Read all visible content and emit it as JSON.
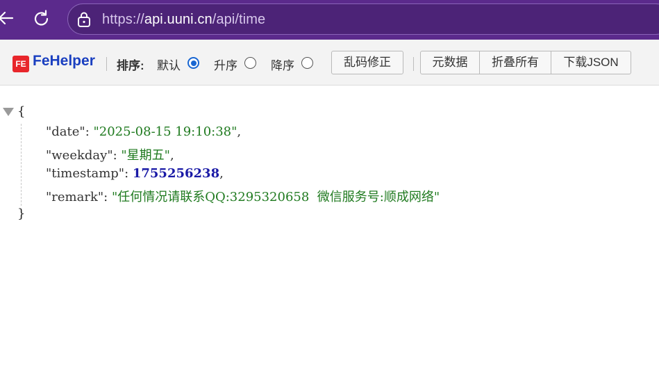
{
  "browser": {
    "url_base": "https://",
    "url_host": "api.uuni.cn",
    "url_path": "/api/time"
  },
  "toolbar": {
    "logo_badge": "FE",
    "logo_text": "FeHelper",
    "sort_label": "排序:",
    "sort_options": [
      {
        "label": "默认",
        "selected": true
      },
      {
        "label": "升序",
        "selected": false
      },
      {
        "label": "降序",
        "selected": false
      }
    ],
    "fix_encoding_label": "乱码修正",
    "metadata_label": "元数据",
    "collapse_all_label": "折叠所有",
    "download_json_label": "下载JSON"
  },
  "json": {
    "open_brace": "{",
    "close_brace": "}",
    "entries": [
      {
        "key": "\"date\"",
        "value": "\"2025-08-15 19:10:38\"",
        "type": "string",
        "trail": ","
      },
      {
        "key": "\"weekday\"",
        "value": "\"星期五\"",
        "type": "string",
        "trail": ","
      },
      {
        "key": "\"timestamp\"",
        "value": "1755256238",
        "type": "number",
        "trail": ","
      },
      {
        "key": "\"remark\"",
        "value": "\"任何情况请联系QQ:3295320658  微信服务号:顺成网络\"",
        "type": "string",
        "trail": ""
      }
    ]
  },
  "colors": {
    "browser_bar": "#5b2a8c",
    "string_value": "#1f7a1f",
    "number_value": "#1a1aa6",
    "logo_blue": "#1a3fc0",
    "logo_red": "#e8262b"
  }
}
